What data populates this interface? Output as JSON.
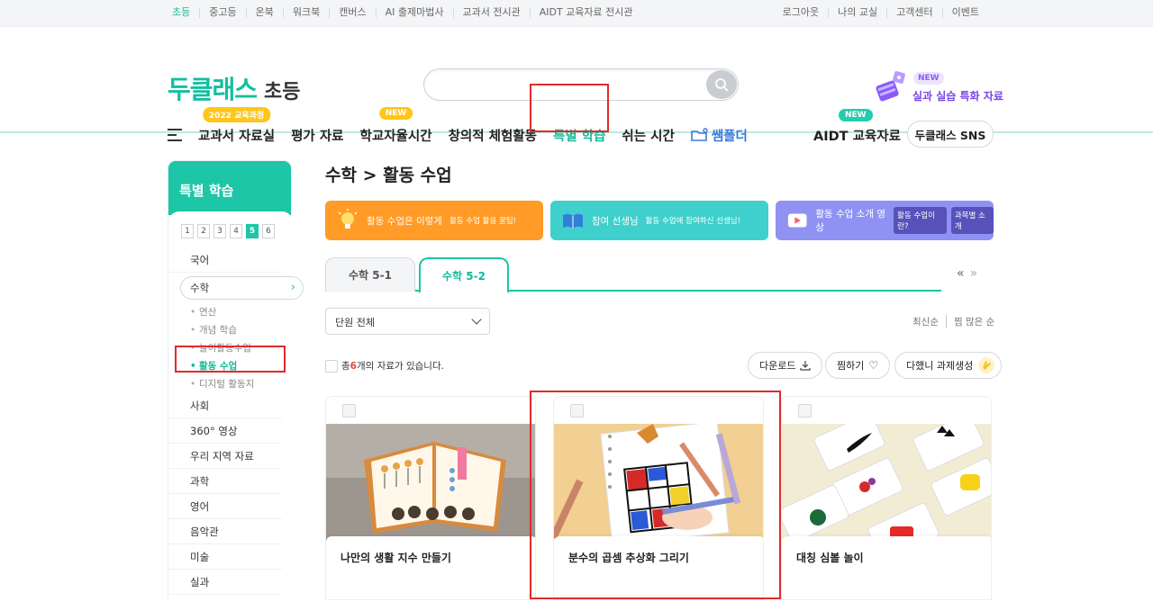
{
  "topbar": {
    "left": [
      "초등",
      "중고등",
      "온북",
      "워크북",
      "캔버스",
      "AI 출제마법사",
      "교과서 전시관",
      "AIDT 교육자료 전시관"
    ],
    "right": [
      "로그아웃",
      "나의 교실",
      "고객센터",
      "이벤트"
    ]
  },
  "logo": {
    "main": "두클래스",
    "sub": "초등"
  },
  "search": {
    "placeholder": ""
  },
  "promo": {
    "badge": "NEW",
    "text": "실과 실습 특화 자료"
  },
  "gnb": {
    "items": [
      {
        "label": "교과서 자료실",
        "badge": "2022 교육과정"
      },
      {
        "label": "평가 자료",
        "badge": ""
      },
      {
        "label": "학교자율시간",
        "badge": "NEW"
      },
      {
        "label": "창의적 체험활동",
        "badge": ""
      },
      {
        "label": "특별 학습",
        "badge": ""
      },
      {
        "label": "쉬는 시간",
        "badge": ""
      },
      {
        "label": "쌤폴더",
        "badge": ""
      }
    ],
    "aidt_label": "AIDT 교육자료",
    "aidt_badge": "NEW",
    "sns_label": "두클래스 SNS"
  },
  "lnb": {
    "title": "특별 학습",
    "grades": [
      "1",
      "2",
      "3",
      "4",
      "5",
      "6"
    ],
    "selected_grade": "5",
    "menu": [
      "국어",
      "수학",
      "사회",
      "360° 영상",
      "우리 지역 자료",
      "과학",
      "영어",
      "음악관",
      "미술",
      "실과"
    ],
    "math_sub": [
      "연산",
      "개념 학습",
      "놀이활동수업",
      "활동 수업",
      "디지털 활동지"
    ]
  },
  "main": {
    "title": "수학 > 활동 수업",
    "banners": [
      {
        "label": "활동 수업은 이렇게",
        "small": "활동 수업 활용 꿀팁!"
      },
      {
        "label": "참여 선생님",
        "small": "활동 수업에 참여하신 선생님!"
      },
      {
        "label": "활동 수업 소개 영상",
        "chip1": "활동 수업이란?",
        "chip2": "과목별 소개"
      }
    ],
    "tabs": [
      "수학 5-1",
      "수학 5-2"
    ],
    "pager": "«  »",
    "select_value": "단원 전체",
    "sort": [
      "최신순",
      "찜 많은 순"
    ],
    "count_prefix": "총 ",
    "count": "6",
    "count_suffix": "개의 자료가 있습니다.",
    "actions": {
      "download": "다운로드",
      "like": "찜하기",
      "task": "다했니 과제생성"
    },
    "cards": [
      "나만의 생활 지수 만들기",
      "분수의 곱셈 추상화 그리기",
      "대칭 심볼 놀이"
    ]
  },
  "colors": {
    "brand": "#1cc6a6",
    "highlight": "#e02b2b",
    "promo": "#7b45e6"
  }
}
